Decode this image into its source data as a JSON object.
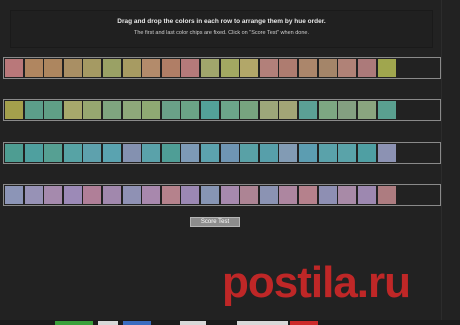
{
  "instructions": {
    "line1": "Drag and drop the colors in each row to arrange them by hue order.",
    "line2": "The first and last color chips are fixed. Click on \"Score Test\" when done."
  },
  "rows": [
    {
      "chips": [
        "#b9787a",
        "#b08660",
        "#ad865f",
        "#a98f64",
        "#a59a63",
        "#9aa165",
        "#a79b62",
        "#b38b6b",
        "#b07e66",
        "#b57a7a",
        "#a1a66c",
        "#a2a862",
        "#b2a769",
        "#b2807a",
        "#ae7c70",
        "#ab866b",
        "#a48569",
        "#b08277",
        "#ac7a7a",
        "#a0a64e"
      ]
    },
    {
      "chips": [
        "#a4a04c",
        "#5c9e8a",
        "#609f86",
        "#a7a86c",
        "#97a770",
        "#7fa57f",
        "#8ea87a",
        "#8fa973",
        "#6aa188",
        "#6ba487",
        "#53a199",
        "#6ca58a",
        "#77a47f",
        "#9da77a",
        "#a2a576",
        "#5ba095",
        "#7da782",
        "#849f81",
        "#8aa57f",
        "#5aa090"
      ]
    },
    {
      "chips": [
        "#4e9d92",
        "#4fa09f",
        "#56a093",
        "#57a3a5",
        "#5ea1ad",
        "#5aa3b0",
        "#8491b0",
        "#5aa2aa",
        "#4f9e96",
        "#7d9ab6",
        "#5ca2ae",
        "#6f95b3",
        "#59a1a6",
        "#579faa",
        "#829bb4",
        "#5c9db1",
        "#5aa2aa",
        "#5aa3a9",
        "#4f9fa3",
        "#8c92b3"
      ]
    },
    {
      "chips": [
        "#8c95b7",
        "#9792b6",
        "#a58aad",
        "#9c8ab7",
        "#b07f98",
        "#a188ad",
        "#8f91b4",
        "#a888ad",
        "#b5828c",
        "#9b88b3",
        "#8795b4",
        "#a689ae",
        "#ad8494",
        "#8b93b3",
        "#ad86a0",
        "#b5818c",
        "#8e8fb3",
        "#a88aa7",
        "#9d88b0",
        "#ad7c80"
      ]
    }
  ],
  "score_button": {
    "label": "Score Test"
  },
  "bottom_buttons": [
    {
      "color": "#3aa03a"
    },
    {
      "color": "#d8d8d8"
    },
    {
      "color": "#3a6cc0"
    },
    {
      "color": "#d8d8d8"
    },
    {
      "color": "#d8d8d8"
    },
    {
      "color": "#d8d8d8"
    },
    {
      "color": "#cc2a2a"
    }
  ],
  "watermark": {
    "text": "postila.ru"
  }
}
